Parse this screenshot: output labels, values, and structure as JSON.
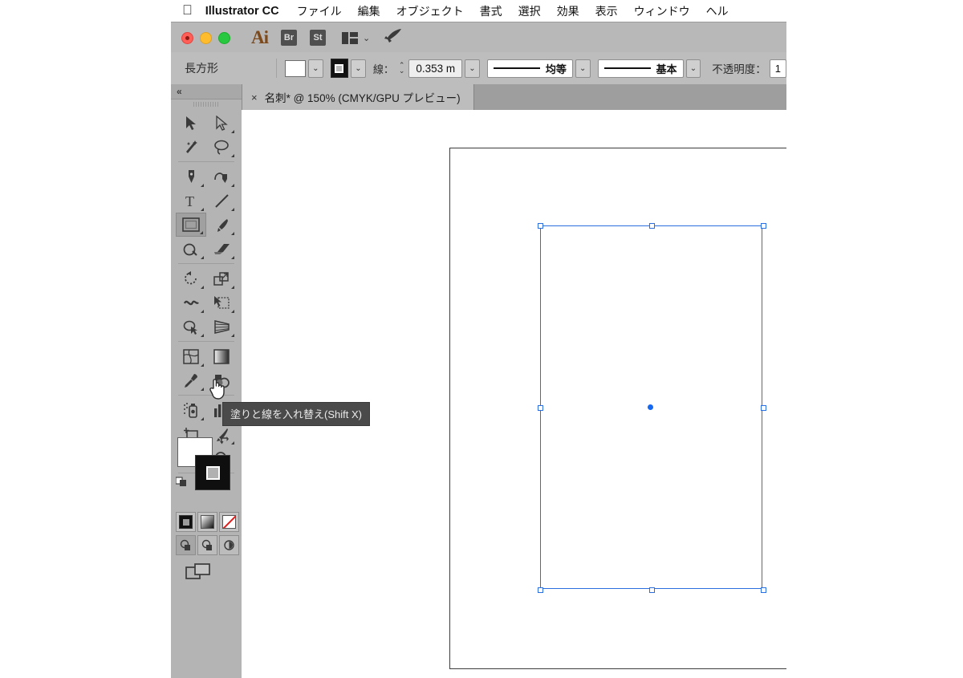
{
  "menubar": {
    "apple_icon": "apple-icon",
    "app_name": "Illustrator CC",
    "items": [
      {
        "label": "ファイル"
      },
      {
        "label": "編集"
      },
      {
        "label": "オブジェクト"
      },
      {
        "label": "書式"
      },
      {
        "label": "選択"
      },
      {
        "label": "効果"
      },
      {
        "label": "表示"
      },
      {
        "label": "ウィンドウ"
      },
      {
        "label": "ヘル"
      }
    ]
  },
  "titlebar": {
    "window_controls": [
      "close",
      "minimize",
      "zoom"
    ],
    "ai_logo": "Ai",
    "bridge_label": "Br",
    "stock_label": "St",
    "arrange_icon": "arrange-documents-icon",
    "arrange_chevron": "⌄",
    "rocket_icon": "rocket-icon"
  },
  "controlbar": {
    "selection_label": "長方形",
    "fill_swatch": "#ffffff",
    "fill_chevron": "⌄",
    "stroke_swatch": "#000000",
    "stroke_chevron": "⌄",
    "stroke_label": "線：",
    "stepper_up": "⌃",
    "stepper_down": "⌄",
    "stroke_weight": "0.353 m",
    "weight_chevron": "⌄",
    "profile_label": "均等",
    "profile_chevron": "⌄",
    "brush_label": "基本",
    "brush_chevron": "⌄",
    "opacity_label": "不透明度：",
    "opacity_value": "1"
  },
  "tabstrip": {
    "close_icon": "×",
    "title": "名刺* @ 150% (CMYK/GPU プレビュー)"
  },
  "leftpanel": {
    "collapse_icon": "«",
    "grip": "panel-grip",
    "tools": [
      {
        "name": "selection-tool",
        "label": "選択ツール",
        "selected": false
      },
      {
        "name": "direct-selection-tool",
        "label": "ダイレクト選択ツール",
        "selected": false
      },
      {
        "name": "magic-wand-tool",
        "label": "自動選択ツール",
        "selected": false
      },
      {
        "name": "lasso-tool",
        "label": "なげなわツール",
        "selected": false
      },
      {
        "name": "pen-tool",
        "label": "ペンツール",
        "selected": false
      },
      {
        "name": "curvature-tool",
        "label": "曲線ツール",
        "selected": false
      },
      {
        "name": "type-tool",
        "label": "文字ツール",
        "selected": false
      },
      {
        "name": "line-segment-tool",
        "label": "直線ツール",
        "selected": false
      },
      {
        "name": "rectangle-tool",
        "label": "長方形ツール",
        "selected": true
      },
      {
        "name": "paintbrush-tool",
        "label": "ブラシツール",
        "selected": false
      },
      {
        "name": "shaper-tool",
        "label": "Shaper ツール",
        "selected": false
      },
      {
        "name": "eraser-tool",
        "label": "消しゴムツール",
        "selected": false
      },
      {
        "name": "rotate-tool",
        "label": "回転ツール",
        "selected": false
      },
      {
        "name": "scale-tool",
        "label": "拡大・縮小ツール",
        "selected": false
      },
      {
        "name": "width-tool",
        "label": "線幅ツール",
        "selected": false
      },
      {
        "name": "free-transform-tool",
        "label": "自由変形ツール",
        "selected": false
      },
      {
        "name": "shape-builder-tool",
        "label": "シェイプ形成ツール",
        "selected": false
      },
      {
        "name": "perspective-grid-tool",
        "label": "遠近グリッドツール",
        "selected": false
      },
      {
        "name": "mesh-tool",
        "label": "メッシュツール",
        "selected": false
      },
      {
        "name": "gradient-tool",
        "label": "グラデーションツール",
        "selected": false
      },
      {
        "name": "eyedropper-tool",
        "label": "スポイトツール",
        "selected": false
      },
      {
        "name": "blend-tool",
        "label": "ブレンドツール",
        "selected": false
      },
      {
        "name": "symbol-sprayer-tool",
        "label": "シンボルスプレーツール",
        "selected": false
      },
      {
        "name": "column-graph-tool",
        "label": "グラフツール",
        "selected": false
      },
      {
        "name": "artboard-tool",
        "label": "アートボードツール",
        "selected": false
      },
      {
        "name": "slice-tool",
        "label": "スライスツール",
        "selected": false
      },
      {
        "name": "hand-tool",
        "label": "手のひらツール",
        "selected": false
      },
      {
        "name": "zoom-tool",
        "label": "ズームツール",
        "selected": false
      }
    ],
    "fill_color": "#ffffff",
    "stroke_color": "#000000",
    "swap_icon": "swap-fill-stroke-icon",
    "default_icon": "default-fill-stroke-icon",
    "color_modes": [
      {
        "name": "color-button",
        "label": "カラー"
      },
      {
        "name": "gradient-button",
        "label": "グラデーション"
      },
      {
        "name": "none-button",
        "label": "なし"
      }
    ],
    "draw_modes": [
      {
        "name": "draw-normal-button",
        "label": "標準描画"
      },
      {
        "name": "draw-behind-button",
        "label": "背面描画"
      },
      {
        "name": "draw-inside-button",
        "label": "内側描画"
      }
    ],
    "screen_mode": {
      "name": "screen-mode-button",
      "label": "スクリーンモードを変更"
    }
  },
  "tooltip": {
    "text": "塗りと線を入れ替え(Shift X)"
  },
  "canvas": {
    "artboard_border": "#3c3c3c",
    "selection_color": "#2a6ee0",
    "center_point_color": "#1668f0",
    "handles": [
      {
        "pos": "top-left"
      },
      {
        "pos": "top-center"
      },
      {
        "pos": "top-right"
      },
      {
        "pos": "middle-left"
      },
      {
        "pos": "middle-right"
      },
      {
        "pos": "bottom-left"
      },
      {
        "pos": "bottom-center"
      },
      {
        "pos": "bottom-right"
      }
    ]
  }
}
